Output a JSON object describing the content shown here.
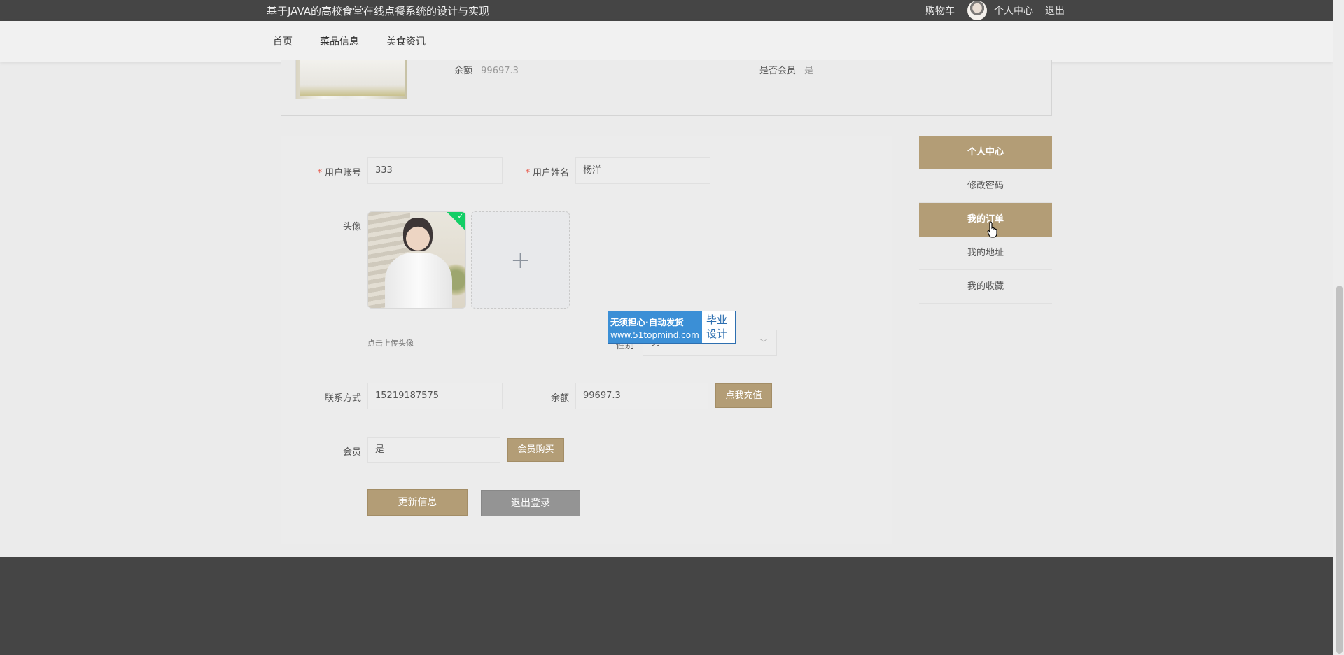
{
  "topbar": {
    "site_title": "基于JAVA的高校食堂在线点餐系统的设计与实现",
    "cart": "购物车",
    "personal_center": "个人中心",
    "logout": "退出"
  },
  "nav": {
    "items": [
      "首页",
      "菜品信息",
      "美食资讯"
    ]
  },
  "profile_card": {
    "balance_label": "余额",
    "balance_value": "99697.3",
    "member_label": "是否会员",
    "member_value": "是"
  },
  "form": {
    "account_label": "用户账号",
    "account_value": "333",
    "name_label": "用户姓名",
    "name_value": "杨洋",
    "avatar_label": "头像",
    "upload_hint": "点击上传头像",
    "gender_label": "性别",
    "gender_value": "男",
    "contact_label": "联系方式",
    "contact_value": "15219187575",
    "balance_label": "余额",
    "balance_value": "99697.3",
    "recharge_button": "点我充值",
    "member_label": "会员",
    "member_value": "是",
    "buy_member_button": "会员购买",
    "update_button": "更新信息",
    "logout_button": "退出登录"
  },
  "watermark": {
    "line1": "无须担心·自动发货",
    "url": "www.51topmind.com",
    "right1": "毕业",
    "right2": "设计"
  },
  "sidebar": {
    "items": [
      "个人中心",
      "修改密码",
      "我的订单",
      "我的地址",
      "我的收藏"
    ],
    "active_indices": [
      0,
      2
    ]
  },
  "colors": {
    "accent": "#b39d76",
    "topbar": "#454545",
    "success": "#13ce66"
  }
}
